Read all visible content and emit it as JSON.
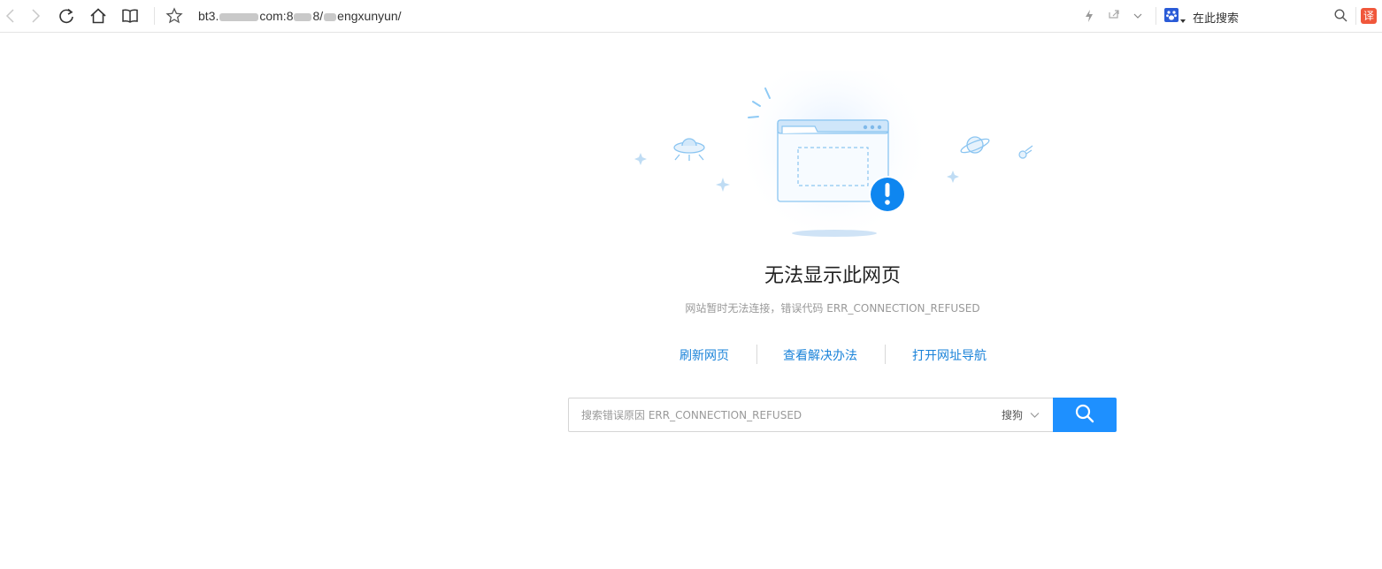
{
  "toolbar": {
    "url_prefix": "bt3.",
    "url_mid": "com:8",
    "url_port_tail": "8/",
    "url_path_tail": "engxunyun/",
    "search_engine_text": "在此搜索",
    "translate_label": "译"
  },
  "error": {
    "title": "无法显示此网页",
    "subtitle": "网站暂时无法连接，错误代码 ERR_CONNECTION_REFUSED"
  },
  "actions": [
    {
      "label": "刷新网页"
    },
    {
      "label": "查看解决办法"
    },
    {
      "label": "打开网址导航"
    }
  ],
  "search": {
    "placeholder": "搜索错误原因 ERR_CONNECTION_REFUSED",
    "engine": "搜狗"
  },
  "colors": {
    "accent": "#1e90ff",
    "link": "#1a83d9",
    "alert": "#0e86f0"
  }
}
